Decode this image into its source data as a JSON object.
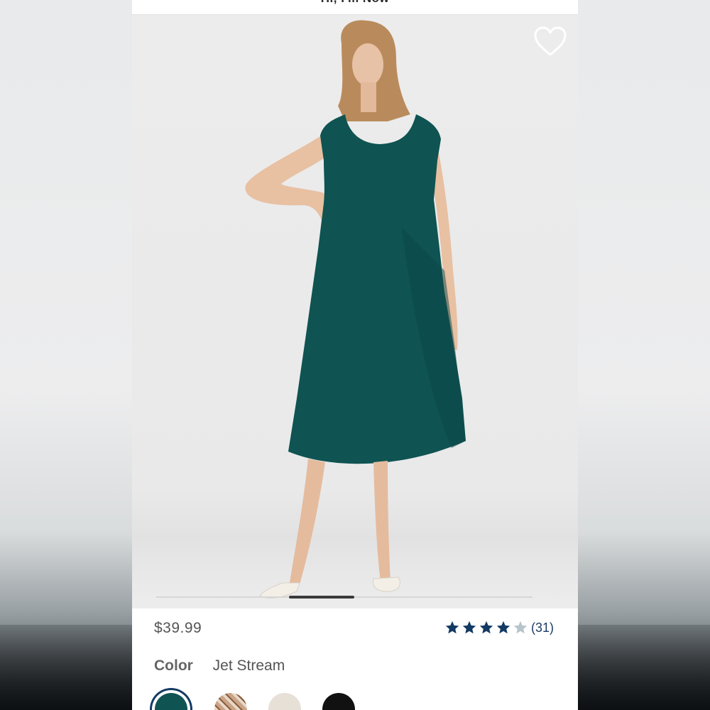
{
  "page": {
    "title": "Hi, I'm Now"
  },
  "product": {
    "price": "$39.99",
    "rating": {
      "stars": 4,
      "max": 5,
      "count": "(31)"
    },
    "color": {
      "label": "Color",
      "value": "Jet Stream"
    }
  },
  "icons": {
    "favorite": "heart-outline-icon",
    "rating_star": "star-icon"
  },
  "swatches": [
    {
      "name": "Jet Stream",
      "color": "#0f5352",
      "selected": true
    },
    {
      "name": "Animal Print",
      "color": "#c9a488",
      "selected": false
    },
    {
      "name": "Cream",
      "color": "#e6e0d6",
      "selected": false
    },
    {
      "name": "Black",
      "color": "#111111",
      "selected": false
    }
  ],
  "colors": {
    "dress": "#0f5352",
    "accent_navy": "#133a63",
    "star_filled": "#133a63",
    "star_empty": "#b8c4cc"
  },
  "carousel": {
    "current": 3,
    "total": 6
  }
}
